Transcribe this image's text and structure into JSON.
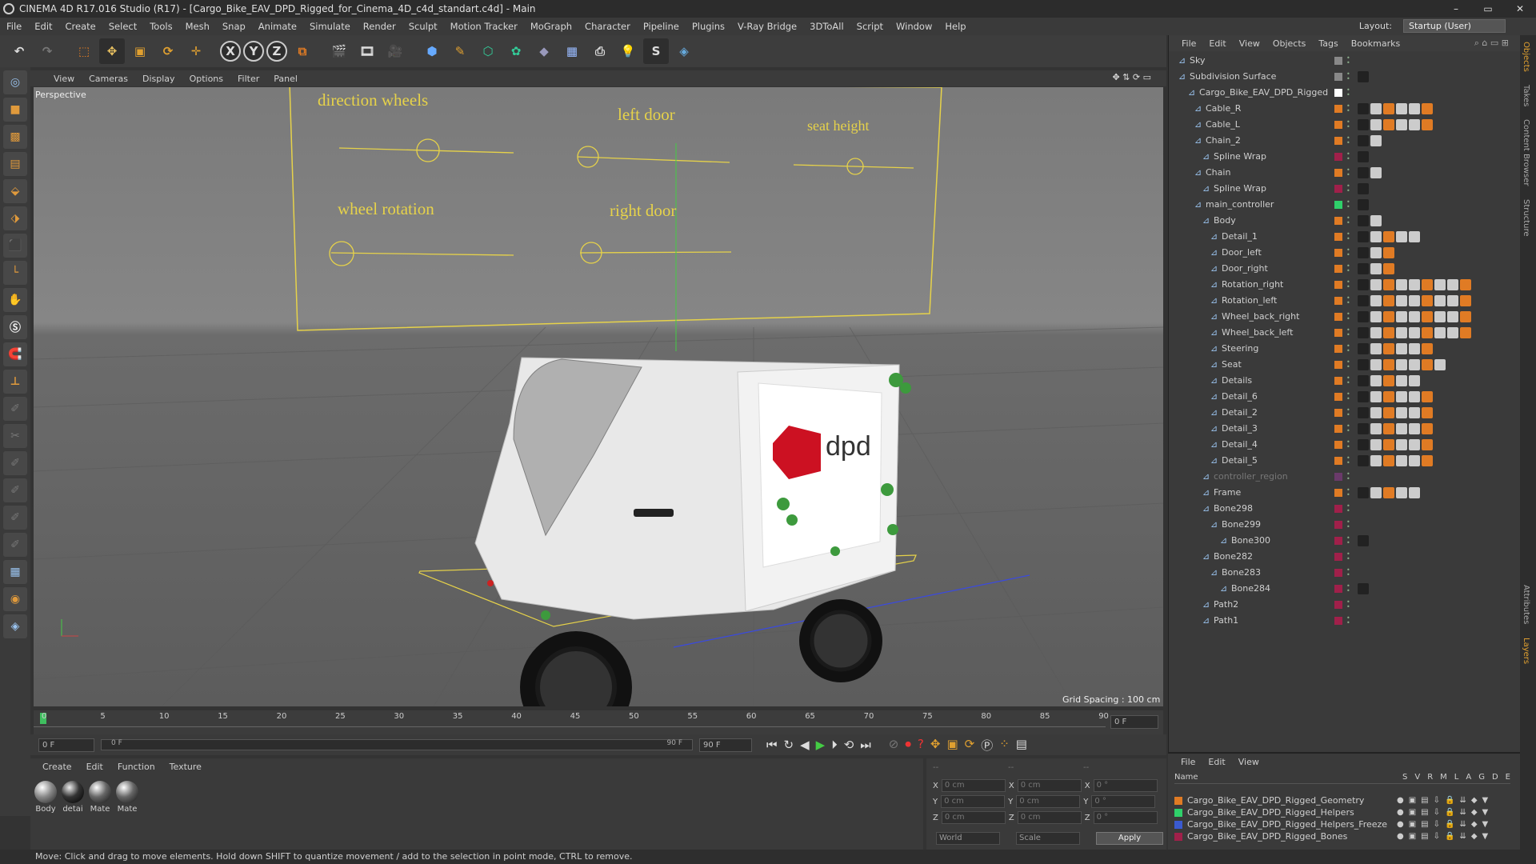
{
  "window": {
    "title": "CINEMA 4D R17.016 Studio (R17) - [Cargo_Bike_EAV_DPD_Rigged_for_Cinema_4D_c4d_standart.c4d] - Main",
    "minimize": "–",
    "maximize": "▭",
    "close": "✕"
  },
  "menu": [
    "File",
    "Edit",
    "Create",
    "Select",
    "Tools",
    "Mesh",
    "Snap",
    "Animate",
    "Simulate",
    "Render",
    "Sculpt",
    "Motion Tracker",
    "MoGraph",
    "Character",
    "Pipeline",
    "Plugins",
    "V-Ray Bridge",
    "3DToAll",
    "Script",
    "Window",
    "Help"
  ],
  "layout": {
    "label": "Layout:",
    "value": "Startup (User)"
  },
  "toolbar": {
    "axis_x": "X",
    "axis_y": "Y",
    "axis_z": "Z"
  },
  "viewport": {
    "menu": [
      "View",
      "Cameras",
      "Display",
      "Options",
      "Filter",
      "Panel"
    ],
    "label": "Perspective",
    "grid_spacing": "Grid Spacing : 100 cm",
    "controls": {
      "direction_wheels": "direction wheels",
      "left_door": "left door",
      "seat_height": "seat height",
      "wheel_rotation": "wheel rotation",
      "right_door": "right door"
    },
    "logo_text": "dpd"
  },
  "timeline": {
    "ticks": [
      "0",
      "5",
      "10",
      "15",
      "20",
      "25",
      "30",
      "35",
      "40",
      "45",
      "50",
      "55",
      "60",
      "65",
      "70",
      "75",
      "80",
      "85",
      "90"
    ],
    "current_frame": "0 F"
  },
  "transport": {
    "start": "0 F",
    "range_start": "0 F",
    "range_end": "90 F",
    "end": "90 F"
  },
  "materials": {
    "menu": [
      "Create",
      "Edit",
      "Function",
      "Texture"
    ],
    "items": [
      "Body",
      "detai",
      "Mate",
      "Mate"
    ]
  },
  "coords": {
    "pos": [
      {
        "axis": "X",
        "value": "0 cm"
      },
      {
        "axis": "Y",
        "value": "0 cm"
      },
      {
        "axis": "Z",
        "value": "0 cm"
      }
    ],
    "size": [
      {
        "axis": "X",
        "value": "0 cm"
      },
      {
        "axis": "Y",
        "value": "0 cm"
      },
      {
        "axis": "Z",
        "value": "0 cm"
      }
    ],
    "rot": [
      {
        "axis": "X",
        "value": "0 °"
      },
      {
        "axis": "Y",
        "value": "0 °"
      },
      {
        "axis": "Z",
        "value": "0 °"
      }
    ],
    "dash1": "--",
    "dash2": "--",
    "dash3": "--",
    "world": "World",
    "scale": "Scale",
    "apply": "Apply"
  },
  "status": "Move: Click and drag to move elements. Hold down SHIFT to quantize movement / add to the selection in point mode, CTRL to remove.",
  "objects": {
    "menu": [
      "File",
      "Edit",
      "View",
      "Objects",
      "Tags",
      "Bookmarks"
    ],
    "rows": [
      {
        "name": "Sky",
        "indent": 0,
        "color": "#888888"
      },
      {
        "name": "Subdivision Surface",
        "indent": 0,
        "color": "#888888"
      },
      {
        "name": "Cargo_Bike_EAV_DPD_Rigged",
        "indent": 1,
        "color": "#ffffff"
      },
      {
        "name": "Cable_R",
        "indent": 2,
        "color": "#e07b24"
      },
      {
        "name": "Cable_L",
        "indent": 2,
        "color": "#e07b24"
      },
      {
        "name": "Chain_2",
        "indent": 2,
        "color": "#e07b24"
      },
      {
        "name": "Spline Wrap",
        "indent": 3,
        "color": "#a0204a"
      },
      {
        "name": "Chain",
        "indent": 2,
        "color": "#e07b24"
      },
      {
        "name": "Spline Wrap",
        "indent": 3,
        "color": "#a0204a"
      },
      {
        "name": "main_controller",
        "indent": 2,
        "color": "#2fd06a"
      },
      {
        "name": "Body",
        "indent": 3,
        "color": "#e07b24"
      },
      {
        "name": "Detail_1",
        "indent": 4,
        "color": "#e07b24"
      },
      {
        "name": "Door_left",
        "indent": 4,
        "color": "#e07b24"
      },
      {
        "name": "Door_right",
        "indent": 4,
        "color": "#e07b24"
      },
      {
        "name": "Rotation_right",
        "indent": 4,
        "color": "#e07b24"
      },
      {
        "name": "Rotation_left",
        "indent": 4,
        "color": "#e07b24"
      },
      {
        "name": "Wheel_back_right",
        "indent": 4,
        "color": "#e07b24"
      },
      {
        "name": "Wheel_back_left",
        "indent": 4,
        "color": "#e07b24"
      },
      {
        "name": "Steering",
        "indent": 4,
        "color": "#e07b24"
      },
      {
        "name": "Seat",
        "indent": 4,
        "color": "#e07b24"
      },
      {
        "name": "Details",
        "indent": 4,
        "color": "#e07b24"
      },
      {
        "name": "Detail_6",
        "indent": 4,
        "color": "#e07b24"
      },
      {
        "name": "Detail_2",
        "indent": 4,
        "color": "#e07b24"
      },
      {
        "name": "Detail_3",
        "indent": 4,
        "color": "#e07b24"
      },
      {
        "name": "Detail_4",
        "indent": 4,
        "color": "#e07b24"
      },
      {
        "name": "Detail_5",
        "indent": 4,
        "color": "#e07b24"
      },
      {
        "name": "controller_region",
        "indent": 3,
        "color": "#6a3a6a"
      },
      {
        "name": "Frame",
        "indent": 3,
        "color": "#e07b24"
      },
      {
        "name": "Bone298",
        "indent": 3,
        "color": "#a0204a"
      },
      {
        "name": "Bone299",
        "indent": 4,
        "color": "#a0204a"
      },
      {
        "name": "Bone300",
        "indent": 5,
        "color": "#a0204a"
      },
      {
        "name": "Bone282",
        "indent": 3,
        "color": "#a0204a"
      },
      {
        "name": "Bone283",
        "indent": 4,
        "color": "#a0204a"
      },
      {
        "name": "Bone284",
        "indent": 5,
        "color": "#a0204a"
      },
      {
        "name": "Path2",
        "indent": 3,
        "color": "#a0204a"
      },
      {
        "name": "Path1",
        "indent": 3,
        "color": "#a0204a"
      }
    ]
  },
  "layers": {
    "menu": [
      "File",
      "Edit",
      "View"
    ],
    "header_name": "Name",
    "header_flags": [
      "S",
      "V",
      "R",
      "M",
      "L",
      "A",
      "G",
      "D",
      "E"
    ],
    "rows": [
      {
        "name": "Cargo_Bike_EAV_DPD_Rigged_Geometry",
        "color": "#e07b24"
      },
      {
        "name": "Cargo_Bike_EAV_DPD_Rigged_Helpers",
        "color": "#2fd06a"
      },
      {
        "name": "Cargo_Bike_EAV_DPD_Rigged_Helpers_Freeze",
        "color": "#3a5ad0"
      },
      {
        "name": "Cargo_Bike_EAV_DPD_Rigged_Bones",
        "color": "#a0204a"
      }
    ]
  },
  "side_tabs": [
    "Objects",
    "Takes",
    "Content Browser",
    "Structure"
  ],
  "side_tabs_bottom": [
    "Attributes",
    "Layers"
  ]
}
